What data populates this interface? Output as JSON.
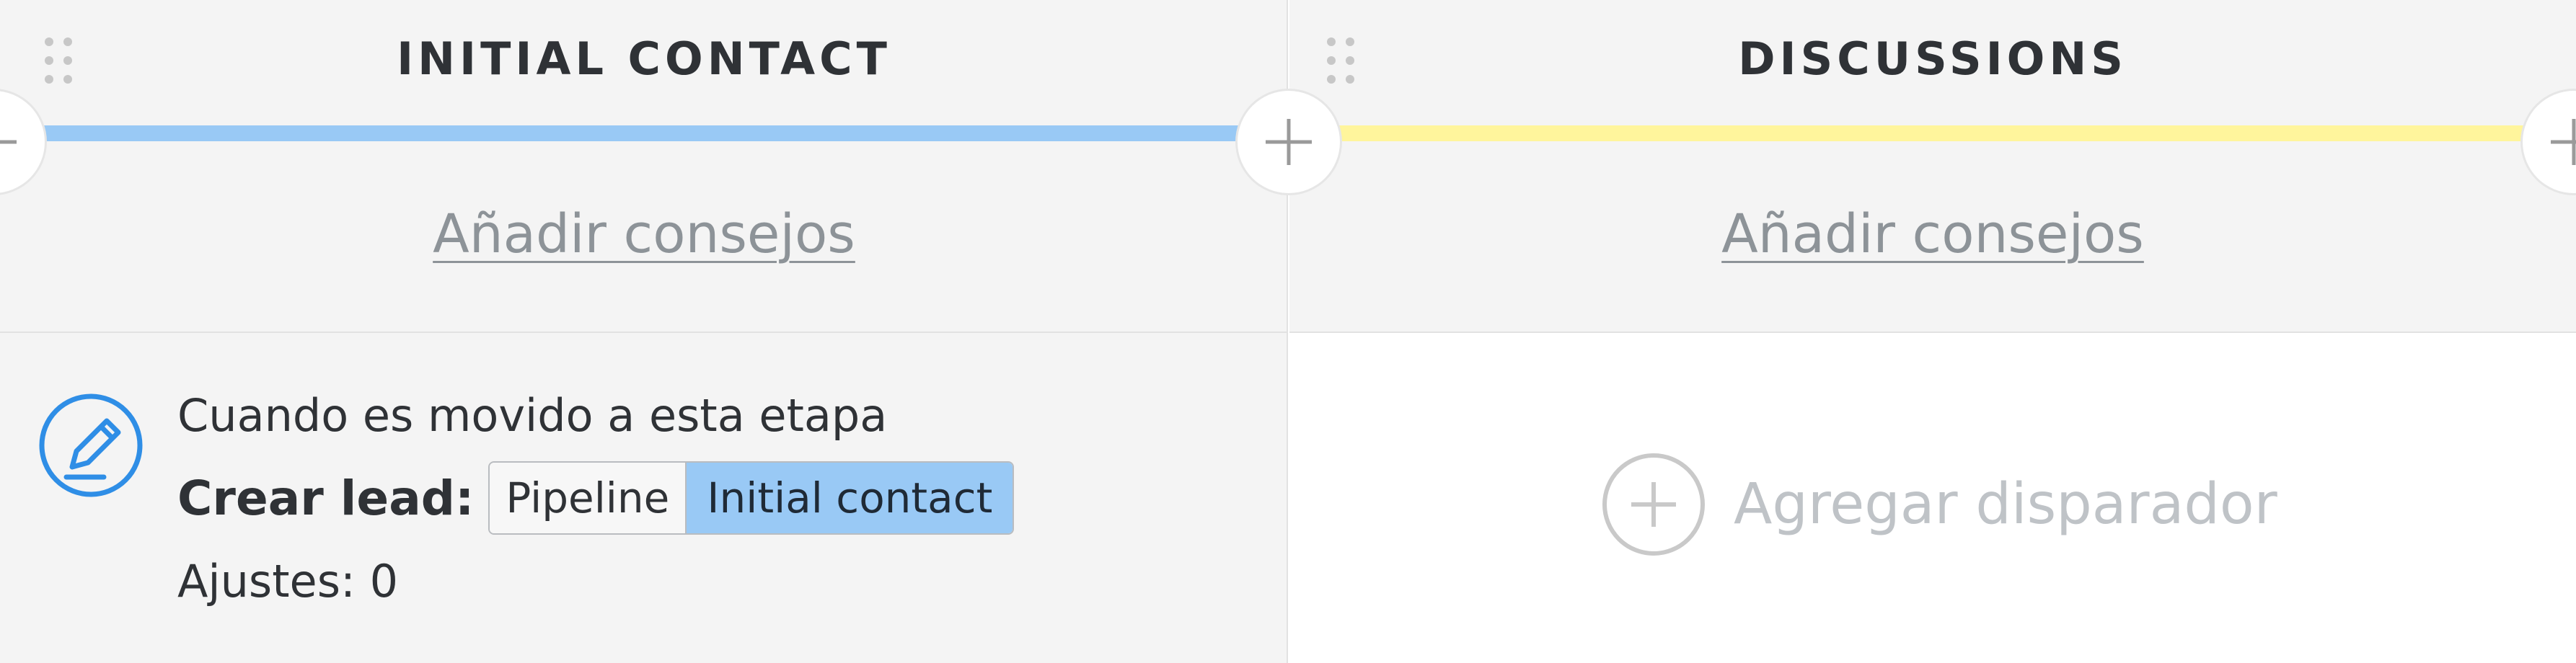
{
  "stages": [
    {
      "title": "INITIAL CONTACT",
      "color": "#99c9f5",
      "tips_link": "Añadir consejos",
      "trigger": {
        "when": "Cuando es movido a esta etapa",
        "action_label": "Crear lead:",
        "pipeline": "Pipeline",
        "stage": "Initial contact",
        "settings": "Ajustes: 0"
      }
    },
    {
      "title": "DISCUSSIONS",
      "color": "#fff59c",
      "tips_link": "Añadir consejos",
      "add_trigger_label": "Agregar disparador"
    }
  ],
  "icons": {
    "drag_handle": "drag-handle-icon",
    "add_stage": "plus-icon",
    "trigger": "edit-icon",
    "add_trigger": "plus-circle-icon"
  }
}
